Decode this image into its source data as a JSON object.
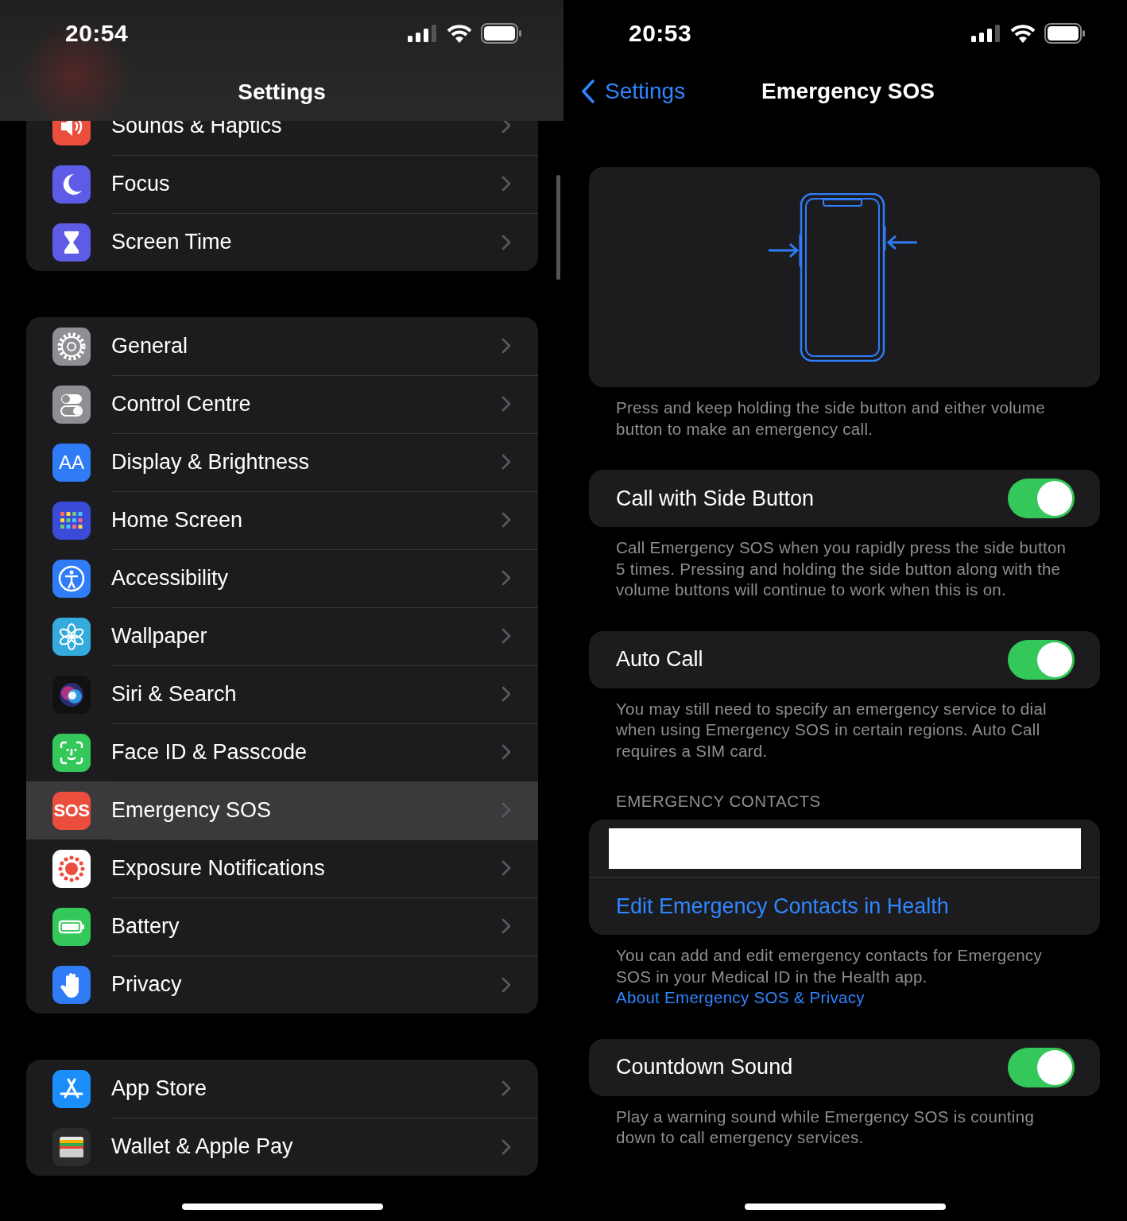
{
  "left": {
    "time": "20:54",
    "title": "Settings",
    "groups": [
      {
        "items": [
          {
            "kind": "sounds",
            "label": "Sounds & Haptics",
            "selected": false
          },
          {
            "kind": "focus",
            "label": "Focus",
            "selected": false
          },
          {
            "kind": "screen_time",
            "label": "Screen Time",
            "selected": false
          }
        ]
      },
      {
        "items": [
          {
            "kind": "general",
            "label": "General",
            "selected": false
          },
          {
            "kind": "control_centre",
            "label": "Control Centre",
            "selected": false
          },
          {
            "kind": "display",
            "icon_text": "AA",
            "label": "Display & Brightness",
            "selected": false
          },
          {
            "kind": "home_screen",
            "label": "Home Screen",
            "selected": false
          },
          {
            "kind": "accessibility",
            "label": "Accessibility",
            "selected": false
          },
          {
            "kind": "wallpaper",
            "label": "Wallpaper",
            "selected": false
          },
          {
            "kind": "siri",
            "label": "Siri & Search",
            "selected": false
          },
          {
            "kind": "face_id",
            "label": "Face ID & Passcode",
            "selected": false
          },
          {
            "kind": "sos",
            "icon_text": "SOS",
            "label": "Emergency SOS",
            "selected": true
          },
          {
            "kind": "exposure",
            "label": "Exposure Notifications",
            "selected": false
          },
          {
            "kind": "battery",
            "label": "Battery",
            "selected": false
          },
          {
            "kind": "privacy",
            "label": "Privacy",
            "selected": false
          }
        ]
      },
      {
        "items": [
          {
            "kind": "app_store",
            "label": "App Store",
            "selected": false
          },
          {
            "kind": "wallet",
            "label": "Wallet & Apple Pay",
            "selected": false
          }
        ]
      }
    ]
  },
  "right": {
    "time": "20:53",
    "back": "Settings",
    "title": "Emergency SOS",
    "blocks": [
      {
        "kind": "illustration"
      },
      {
        "kind": "footer",
        "text": "Press and keep holding the side button and either volume button to make an emergency call."
      },
      {
        "kind": "toggle",
        "label": "Call with Side Button",
        "on": true
      },
      {
        "kind": "footer",
        "text": "Call Emergency SOS when you rapidly press the side button 5 times. Pressing and holding the side button along with the volume buttons will continue to work when this is on."
      },
      {
        "kind": "toggle",
        "label": "Auto Call",
        "on": true
      },
      {
        "kind": "footer",
        "text": "You may still need to specify an emergency service to dial when using Emergency SOS in certain regions. Auto Call requires a SIM card."
      },
      {
        "kind": "header",
        "text": "EMERGENCY CONTACTS"
      },
      {
        "kind": "contacts",
        "rows": [
          {
            "kind": "redacted"
          },
          {
            "kind": "link",
            "label": "Edit Emergency Contacts in Health"
          }
        ]
      },
      {
        "kind": "footer",
        "text": "You can add and edit emergency contacts for Emergency SOS in your Medical ID in the Health app.",
        "link": "About Emergency SOS & Privacy"
      },
      {
        "kind": "toggle",
        "label": "Countdown Sound",
        "on": true
      },
      {
        "kind": "footer",
        "text": "Play a warning sound while Emergency SOS is counting down to call emergency services."
      }
    ]
  }
}
